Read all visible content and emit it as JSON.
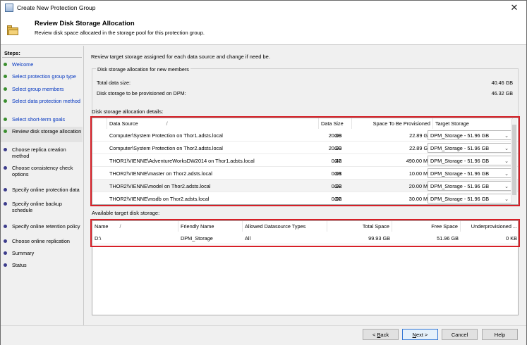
{
  "window": {
    "title": "Create New Protection Group",
    "close_glyph": "✕"
  },
  "header": {
    "title": "Review Disk Storage Allocation",
    "subtitle": "Review disk space allocated in the storage pool for this protection group."
  },
  "steps": {
    "heading": "Steps:",
    "items": [
      {
        "label": "Welcome",
        "state": "done"
      },
      {
        "label": "Select protection group type",
        "state": "done"
      },
      {
        "label": "Select group members",
        "state": "done"
      },
      {
        "label": "Select data protection method",
        "state": "done"
      },
      {
        "label": "Select short-term goals",
        "state": "done"
      },
      {
        "label": "Review disk storage allocation",
        "state": "current"
      },
      {
        "label": "Choose replica creation method",
        "state": "todo"
      },
      {
        "label": "Choose consistency check options",
        "state": "todo"
      },
      {
        "label": "Specify online protection data",
        "state": "todo"
      },
      {
        "label": "Specify online backup schedule",
        "state": "todo"
      },
      {
        "label": "Specify online retention policy",
        "state": "todo"
      },
      {
        "label": "Choose online replication",
        "state": "todo"
      },
      {
        "label": "Summary",
        "state": "todo"
      },
      {
        "label": "Status",
        "state": "todo"
      }
    ]
  },
  "main": {
    "intro": "Review target storage assigned for each data source and change if need be.",
    "new_members": {
      "label": "Disk storage allocation for new members",
      "total_label": "Total data size:",
      "total_value": "40.46 GB",
      "provision_label": "Disk storage to be provisioned on DPM:",
      "provision_value": "46.32 GB"
    },
    "details_label": "Disk storage allocation details:",
    "details": {
      "columns": [
        "Data Source",
        "Data Size",
        "Space To Be Provisioned",
        "Target Storage"
      ],
      "sort_glyph": "/",
      "rows": [
        {
          "source": "Computer\\System Protection on Thor1.adsts.local",
          "size": "20.00",
          "unit": "GB",
          "space": "22.89 GB",
          "target": "DPM_Storage - 51.96 GB"
        },
        {
          "source": "Computer\\System Protection on Thor2.adsts.local",
          "size": "20.00",
          "unit": "GB",
          "space": "22.89 GB",
          "target": "DPM_Storage - 51.96 GB"
        },
        {
          "source": "THOR1\\VIENNE\\AdventureWorksDW2014 on Thor1.adsts.local",
          "size": "0.42",
          "unit": "GB",
          "space": "490.00 MB",
          "target": "DPM_Storage - 51.96 GB"
        },
        {
          "source": "THOR2\\VIENNE\\master on Thor2.adsts.local",
          "size": "0.01",
          "unit": "GB",
          "space": "10.00 MB",
          "target": "DPM_Storage - 51.96 GB"
        },
        {
          "source": "THOR2\\VIENNE\\model on Thor2.adsts.local",
          "size": "0.02",
          "unit": "GB",
          "space": "20.00 MB",
          "target": "DPM_Storage - 51.96 GB"
        },
        {
          "source": "THOR2\\VIENNE\\msdb on Thor2.adsts.local",
          "size": "0.02",
          "unit": "GB",
          "space": "30.00 MB",
          "target": "DPM_Storage - 51.96 GB"
        }
      ]
    },
    "available_label": "Available target disk storage:",
    "available": {
      "columns": [
        "Name",
        "Friendly Name",
        "Allowed Datasource Types",
        "Total Space",
        "Free Space",
        "Underprovisioned ..."
      ],
      "rows": [
        {
          "name": "D:\\",
          "friendly": "DPM_Storage",
          "types": "All",
          "total": "99.93 GB",
          "free": "51.96 GB",
          "under": "0 KB"
        }
      ]
    }
  },
  "footer": {
    "back": "< Back",
    "back_key": "B",
    "next": "Next >",
    "next_key": "N",
    "cancel": "Cancel",
    "help": "Help"
  },
  "colors": {
    "highlight": "#d61f27",
    "link": "#0034c0",
    "done_dot": "#3a8e2e",
    "todo_dot": "#3d3d8c"
  }
}
